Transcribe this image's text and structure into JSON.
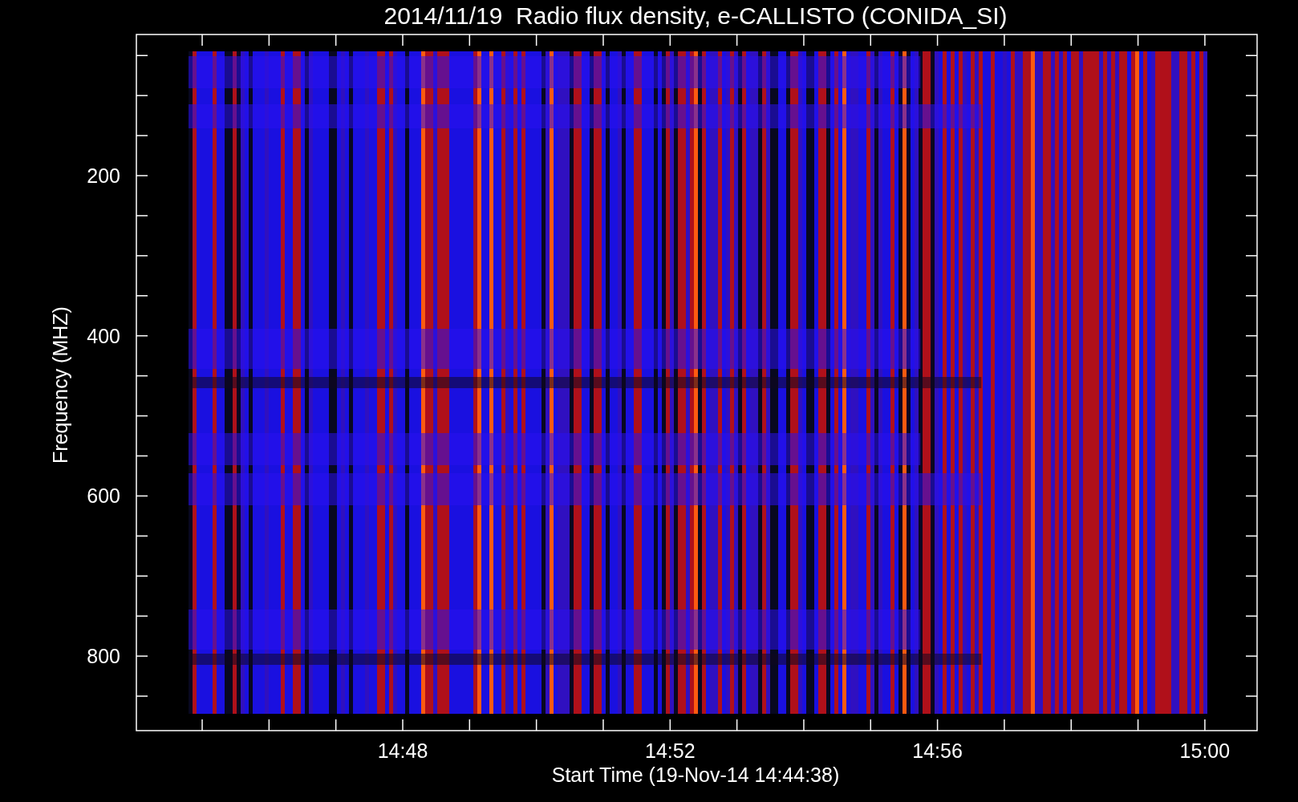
{
  "title": "2014/11/19  Radio flux density, e-CALLISTO (CONIDA_SI)",
  "y_axis": {
    "label": "Frequency (MHZ)",
    "ticks": [
      "200",
      "400",
      "600",
      "800"
    ]
  },
  "x_axis": {
    "label": "Start Time (19-Nov-14 14:44:38)",
    "ticks": [
      "14:48",
      "14:52",
      "14:56",
      "15:00"
    ]
  }
}
